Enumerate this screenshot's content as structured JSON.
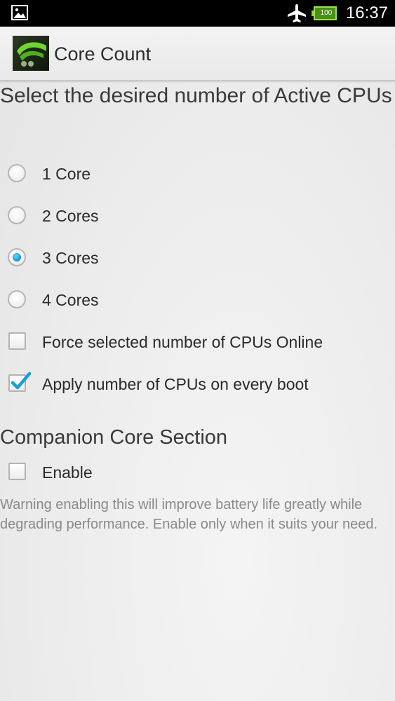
{
  "status_bar": {
    "time": "16:37",
    "battery_level": "100",
    "icons": [
      "gallery-notification-icon",
      "airplane-mode-icon",
      "battery-icon"
    ]
  },
  "action_bar": {
    "title": "Core Count",
    "icon": "core-count-app-icon"
  },
  "main": {
    "heading": "Select the desired number of Active CPUs",
    "core_options": [
      {
        "label": "1 Core",
        "checked": false
      },
      {
        "label": "2 Cores",
        "checked": false
      },
      {
        "label": "3 Cores",
        "checked": true
      },
      {
        "label": "4 Cores",
        "checked": false
      }
    ],
    "checkboxes": [
      {
        "label": "Force selected number of CPUs Online",
        "checked": false
      },
      {
        "label": "Apply number of CPUs on every boot",
        "checked": true
      }
    ]
  },
  "companion": {
    "title": "Companion Core Section",
    "enable": {
      "label": "Enable",
      "checked": false
    },
    "warning": "Warning enabling this will improve battery life greatly while degrading performance. Enable only when it suits your need."
  },
  "colors": {
    "accent": "#1a9ed6",
    "status_bar_bg": "#000000",
    "action_bar_bg": "#efefef",
    "warning_text": "#8a8a8a"
  }
}
